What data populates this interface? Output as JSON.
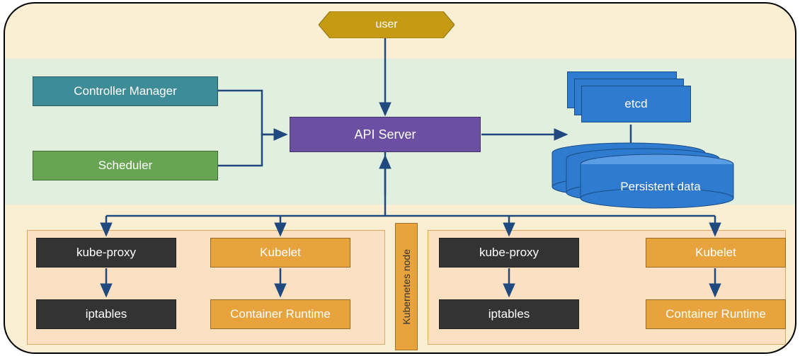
{
  "user": {
    "label": "user"
  },
  "control_plane": {
    "controller_manager": "Controller Manager",
    "scheduler": "Scheduler",
    "api_server": "API Server",
    "etcd": "etcd",
    "persistent_data": "Persistent data"
  },
  "node_label": "Kubernetes node",
  "nodes": [
    {
      "kube_proxy": "kube-proxy",
      "kubelet": "Kubelet",
      "iptables": "iptables",
      "container_runtime": "Container Runtime"
    },
    {
      "kube_proxy": "kube-proxy",
      "kubelet": "Kubelet",
      "iptables": "iptables",
      "container_runtime": "Container Runtime"
    }
  ],
  "colors": {
    "arrow": "#20497f",
    "user_fill": "#c59b14",
    "api_fill": "#6a4fa3",
    "etcd_fill": "#2f7bd0",
    "orange": "#e8a33d",
    "dark": "#333333",
    "teal": "#3e8c97",
    "leaf": "#68a553"
  }
}
